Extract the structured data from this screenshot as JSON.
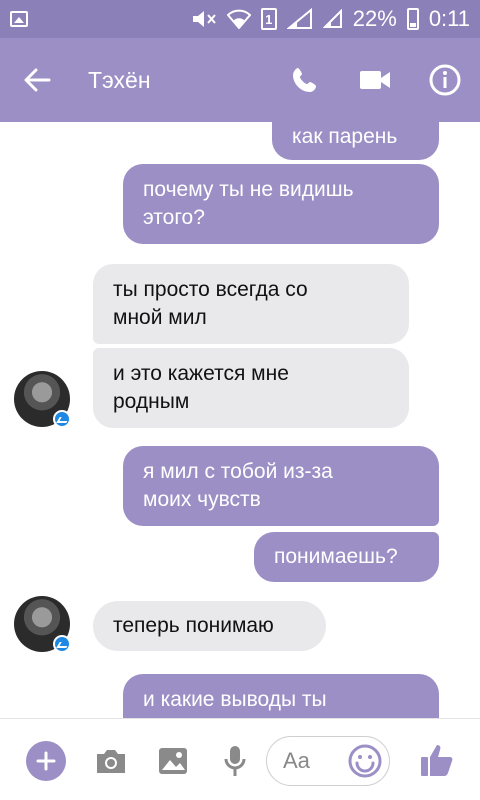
{
  "status_bar": {
    "sim_label": "1",
    "battery": "22%",
    "time": "0:11"
  },
  "header": {
    "contact_name": "Тэхён",
    "icons": {
      "back": "arrow-left-icon",
      "call": "phone-icon",
      "video": "video-camera-icon",
      "info": "info-icon"
    }
  },
  "messages": [
    {
      "direction": "out",
      "lines": [
        "как парень"
      ]
    },
    {
      "direction": "out",
      "lines": [
        "почему ты не видишь",
        "этого?"
      ]
    },
    {
      "direction": "in",
      "lines": [
        "ты просто всегда со",
        "мной мил"
      ]
    },
    {
      "direction": "in",
      "lines": [
        "и это кажется мне",
        "родным"
      ]
    },
    {
      "direction": "out",
      "lines": [
        "я мил с тобой из-за",
        "моих чувств"
      ]
    },
    {
      "direction": "out",
      "lines": [
        "понимаешь?"
      ]
    },
    {
      "direction": "in",
      "lines": [
        "теперь понимаю"
      ]
    },
    {
      "direction": "out",
      "lines": [
        "и какие выводы ты"
      ]
    }
  ],
  "composer": {
    "placeholder": "Aa",
    "icons": [
      "plus-icon",
      "camera-icon",
      "image-icon",
      "microphone-icon",
      "emoji-icon",
      "thumbs-up-icon"
    ]
  },
  "colors": {
    "status_bar": "#8c80b8",
    "accent": "#9c8fc6",
    "incoming_bubble": "#e9e9eb",
    "messenger_badge": "#1e88e5"
  }
}
